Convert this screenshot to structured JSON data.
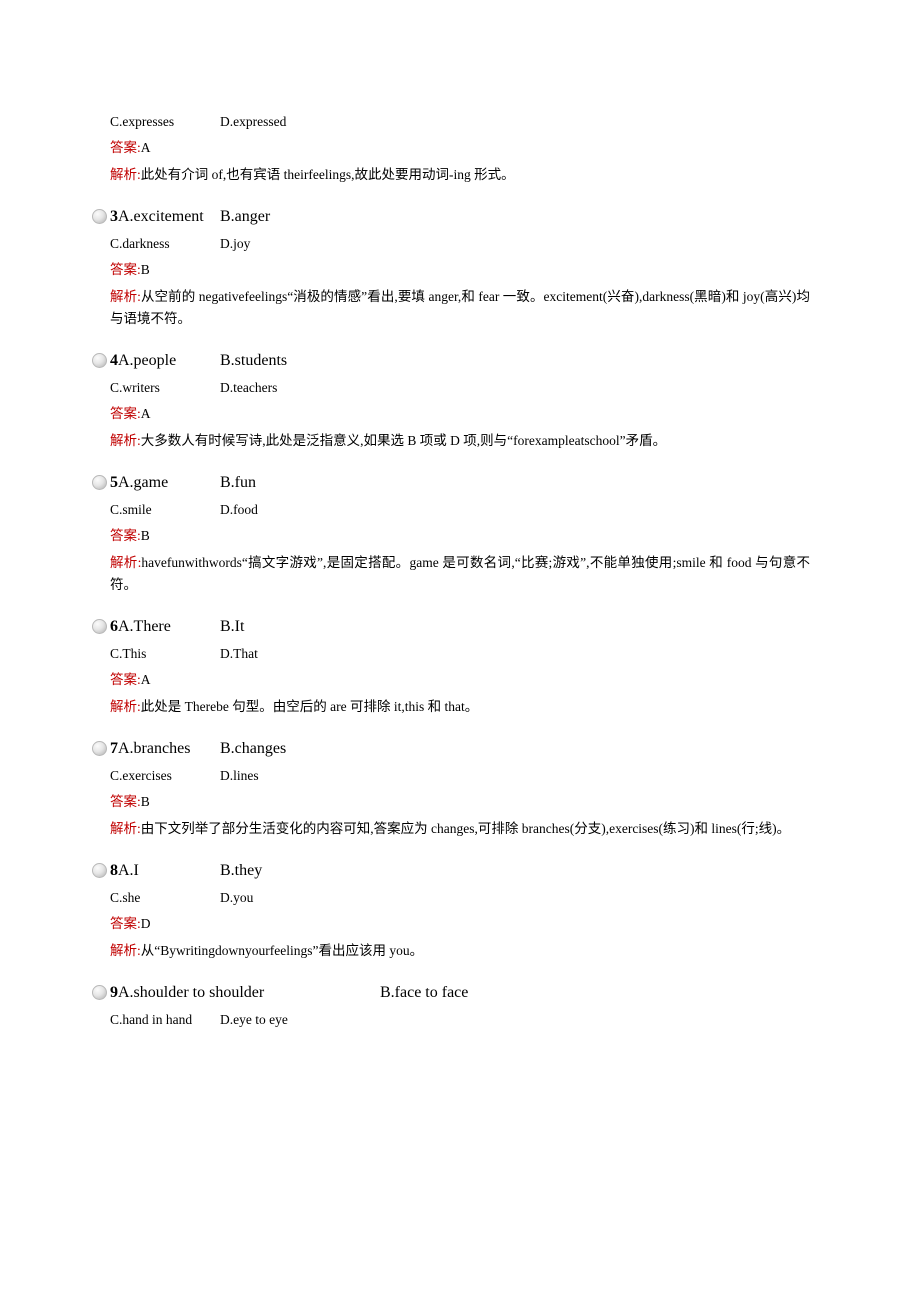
{
  "page": {
    "top_block": {
      "option_c": "C.expresses",
      "option_d": "D.expressed",
      "answer_label": "答案:",
      "answer_value": "A",
      "explain_label": "解析:",
      "explain_text": "此处有介词 of,也有宾语 theirfeelings,故此处要用动词-ing 形式。"
    },
    "questions": [
      {
        "number": "3",
        "option_a": "A.excitement",
        "option_b": "B.anger",
        "option_c": "C.darkness",
        "option_d": "D.joy",
        "answer_label": "答案:",
        "answer_value": "B",
        "explain_label": "解析:",
        "explain_text": "从空前的 negativefeelings“消极的情感”看出,要填 anger,和 fear 一致。excitement(兴奋),darkness(黑暗)和 joy(高兴)均与语境不符。"
      },
      {
        "number": "4",
        "option_a": "A.people",
        "option_b": "B.students",
        "option_c": "C.writers",
        "option_d": "D.teachers",
        "answer_label": "答案:",
        "answer_value": "A",
        "explain_label": "解析:",
        "explain_text": "大多数人有时候写诗,此处是泛指意义,如果选 B 项或 D 项,则与“forexampleatschool”矛盾。"
      },
      {
        "number": "5",
        "option_a": "A.game",
        "option_b": "B.fun",
        "option_c": "C.smile",
        "option_d": "D.food",
        "answer_label": "答案:",
        "answer_value": "B",
        "explain_label": "解析:",
        "explain_text": "havefunwithwords“搞文字游戏”,是固定搭配。game 是可数名词,“比赛;游戏”,不能单独使用;smile 和 food 与句意不符。"
      },
      {
        "number": "6",
        "option_a": "A.There",
        "option_b": "B.It",
        "option_c": "C.This",
        "option_d": "D.That",
        "answer_label": "答案:",
        "answer_value": "A",
        "explain_label": "解析:",
        "explain_text": "此处是 Therebe 句型。由空后的 are 可排除 it,this 和 that。"
      },
      {
        "number": "7",
        "option_a": "A.branches",
        "option_b": "B.changes",
        "option_c": "C.exercises",
        "option_d": "D.lines",
        "answer_label": "答案:",
        "answer_value": "B",
        "explain_label": "解析:",
        "explain_text": "由下文列举了部分生活变化的内容可知,答案应为 changes,可排除 branches(分支),exercises(练习)和 lines(行;线)。"
      },
      {
        "number": "8",
        "option_a": "A.I",
        "option_b": "B.they",
        "option_c": "C.she",
        "option_d": "D.you",
        "answer_label": "答案:",
        "answer_value": "D",
        "explain_label": "解析:",
        "explain_text": "从“Bywritingdownyourfeelings”看出应该用 you。"
      },
      {
        "number": "9",
        "option_a": "A.shoulder to shoulder",
        "option_b": "B.face to face",
        "option_c": "C.hand in hand",
        "option_d": "D.eye to eye",
        "wide": true
      }
    ]
  }
}
